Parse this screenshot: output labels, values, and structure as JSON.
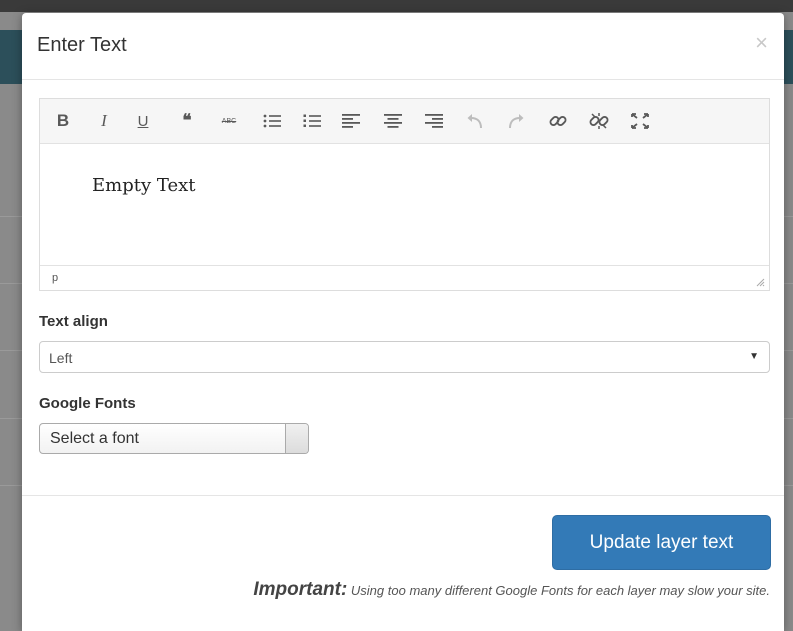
{
  "modal": {
    "title": "Enter Text",
    "close_glyph": "×"
  },
  "editor": {
    "toolbar": [
      {
        "name": "bold",
        "glyph": "B"
      },
      {
        "name": "italic",
        "glyph": "I"
      },
      {
        "name": "underline",
        "glyph": "U"
      },
      {
        "name": "blockquote",
        "glyph": "66"
      },
      {
        "name": "strikethrough",
        "glyph": "ABC"
      },
      {
        "name": "bullet-list"
      },
      {
        "name": "numbered-list"
      },
      {
        "name": "align-left"
      },
      {
        "name": "align-center"
      },
      {
        "name": "align-right"
      },
      {
        "name": "undo"
      },
      {
        "name": "redo"
      },
      {
        "name": "link"
      },
      {
        "name": "unlink"
      },
      {
        "name": "fullscreen"
      }
    ],
    "content": "Empty Text",
    "path": "p"
  },
  "form": {
    "text_align_label": "Text align",
    "text_align_value": "Left",
    "google_fonts_label": "Google Fonts",
    "font_placeholder": "Select a font"
  },
  "footer": {
    "update_button": "Update layer text",
    "note_strong": "Important:",
    "note_text": " Using too many different Google Fonts for each layer may slow your site."
  },
  "colors": {
    "primary": "#337ab7",
    "backdrop_teal": "#2c4f5a"
  }
}
